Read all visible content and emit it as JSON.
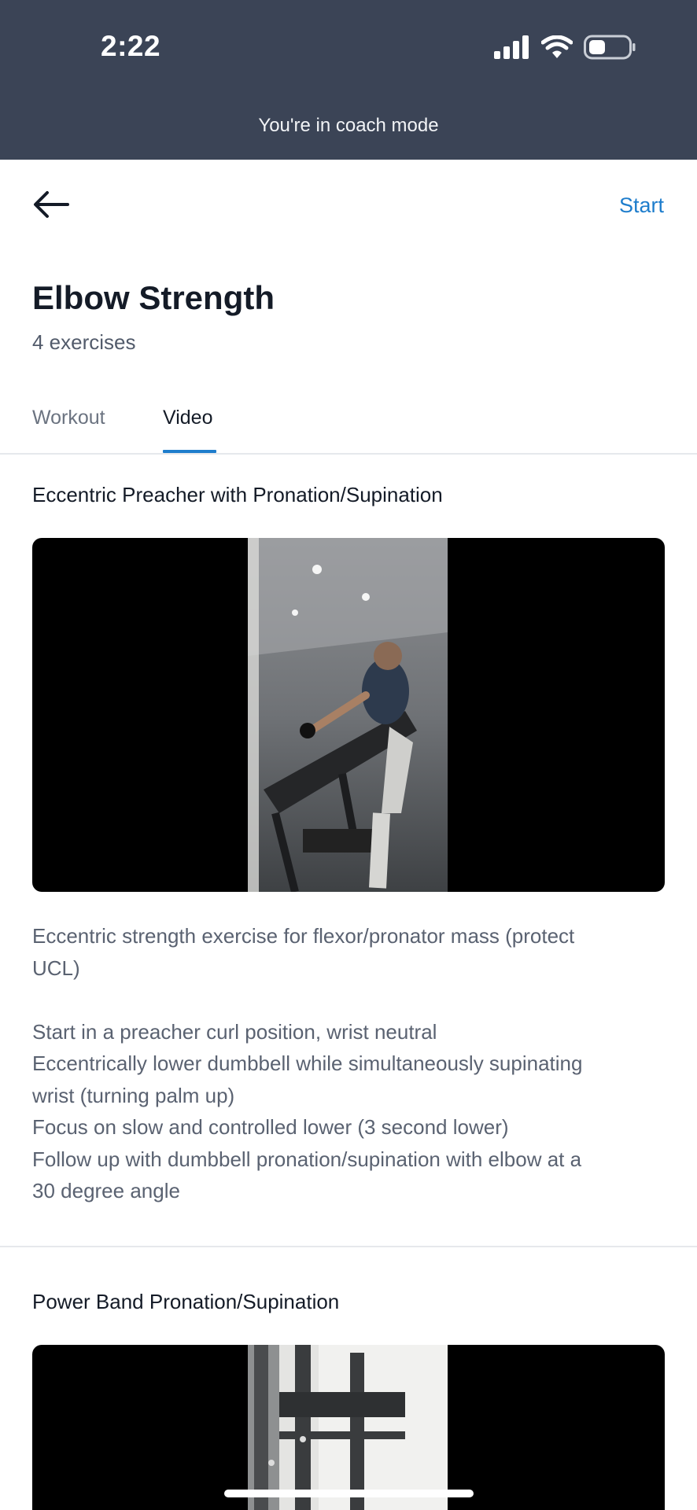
{
  "status_bar": {
    "time": "2:22",
    "icons": [
      "signal-icon",
      "wifi-icon",
      "battery-icon"
    ]
  },
  "banner": {
    "text": "You're in coach mode",
    "color": "#3b4456"
  },
  "nav": {
    "back_icon": "arrow-left-icon",
    "start_label": "Start",
    "accent": "#1e7dcc"
  },
  "workout": {
    "title": "Elbow Strength",
    "subtitle": "4 exercises"
  },
  "tabs": [
    {
      "label": "Workout",
      "active": false
    },
    {
      "label": "Video",
      "active": true
    }
  ],
  "exercises": [
    {
      "title": "Eccentric Preacher with Pronation/Supination",
      "video_label": "exercise video thumbnail",
      "description": [
        "Eccentric strength exercise for flexor/pronator mass (protect",
        "UCL)",
        "",
        "Start in a preacher curl position, wrist neutral",
        "Eccentrically lower dumbbell while simultaneously supinating",
        "wrist (turning palm up)",
        "Focus on slow and controlled lower (3 second lower)",
        "Follow up with dumbbell pronation/supination with elbow at a",
        "30 degree angle"
      ]
    },
    {
      "title": "Power Band Pronation/Supination",
      "video_label": "exercise video thumbnail"
    }
  ]
}
